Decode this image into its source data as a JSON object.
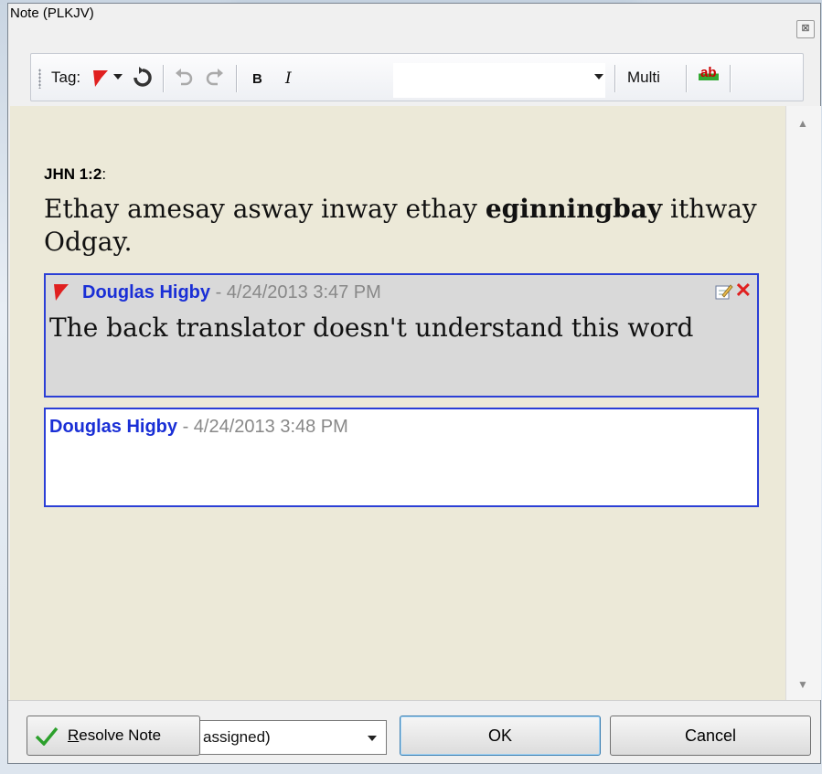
{
  "window": {
    "title": "Note (PLKJV)",
    "close_glyph": "⊠"
  },
  "toolbar": {
    "tag_label": "Tag:",
    "bold_label": "B",
    "italic_label": "I",
    "font_value": "",
    "multi_label": "Multi",
    "spell_label": "ab",
    "icons": [
      "flag-icon",
      "chevron-down-icon",
      "refresh-icon",
      "undo-icon",
      "redo-icon",
      "spellcheck-icon"
    ]
  },
  "verse": {
    "reference": "JHN 1:2",
    "reference_suffix": ":",
    "text_before": "Ethay amesay asway inway ethay ",
    "text_bold": "eginningbay",
    "text_after": " ithway Odgay."
  },
  "comments": [
    {
      "author": "Douglas Higby",
      "timestamp": " - 4/24/2013 3:47 PM",
      "body": "The back translator doesn't understand this word",
      "flagged": true
    },
    {
      "author": "Douglas Higby",
      "timestamp": " - 4/24/2013 3:48 PM",
      "body": "",
      "flagged": false
    }
  ],
  "footer": {
    "resolve_label_u": "R",
    "resolve_label_rest": "esolve Note",
    "assign_value": "assigned)",
    "ok_label": "OK",
    "cancel_label": "Cancel"
  },
  "colors": {
    "accent": "#1a2fd6",
    "content_bg": "#ece9d8",
    "flag": "#e02020",
    "selected_comment_bg": "#d9d9d9"
  }
}
